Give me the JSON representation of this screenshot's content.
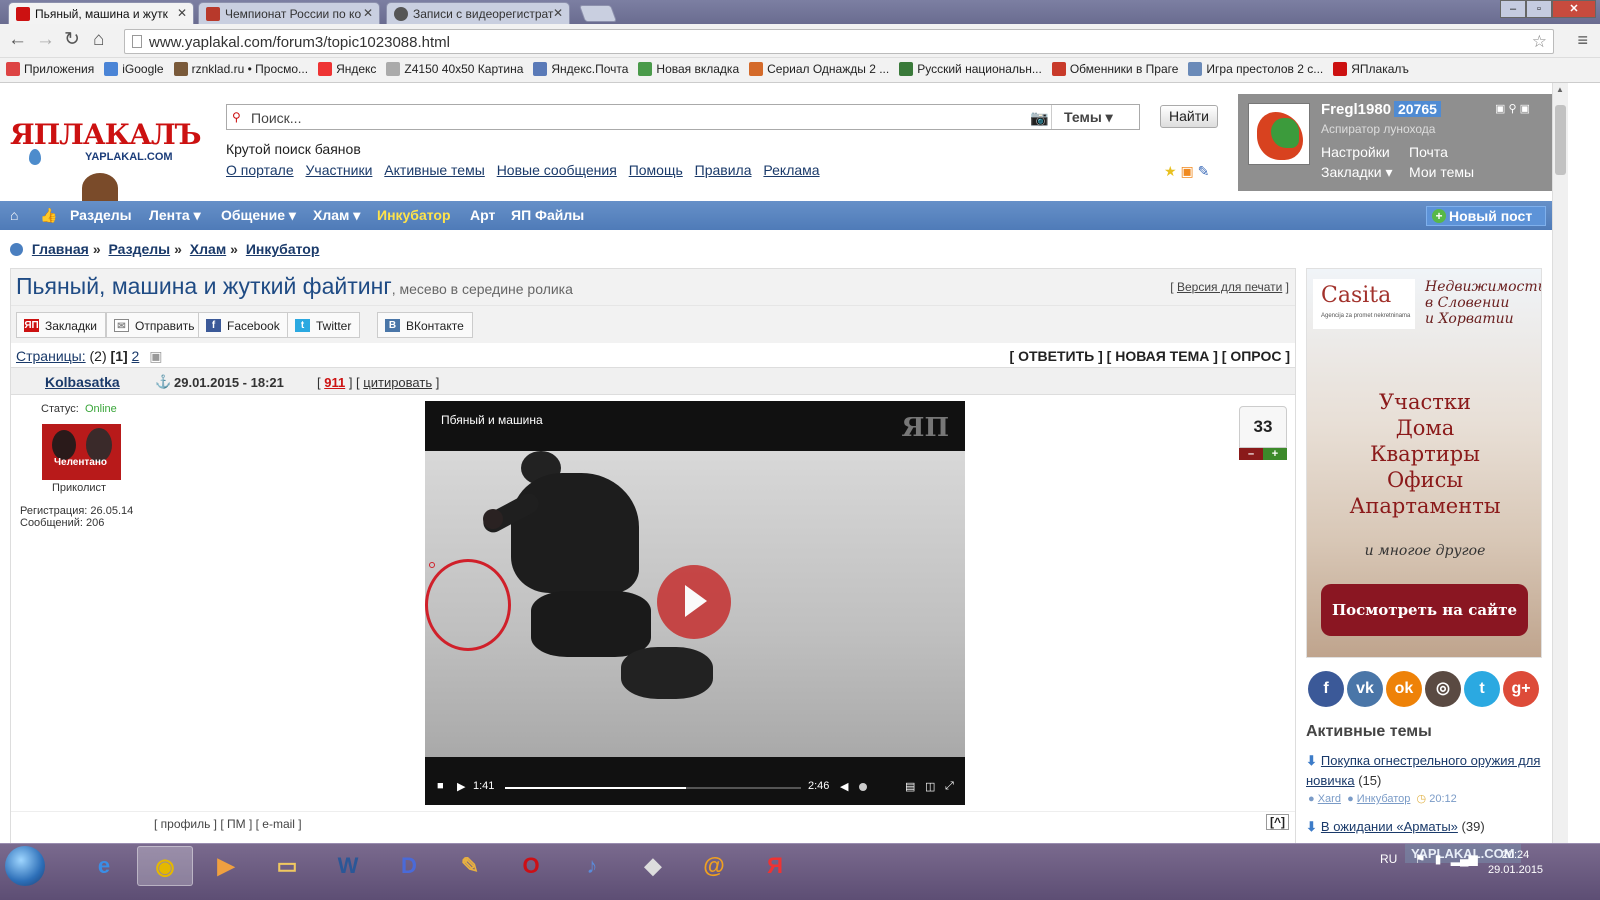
{
  "browser": {
    "tabs": [
      {
        "title": "Пьяный, машина и жутк",
        "favicon": "yaplakal-favicon",
        "color": "#c11",
        "active": true
      },
      {
        "title": "Чемпионат России по ко",
        "favicon": "video-favicon",
        "color": "#b8392b",
        "active": false
      },
      {
        "title": "Записи с видеорегистрат",
        "favicon": "globe-favicon",
        "color": "#555",
        "active": false
      }
    ],
    "url": "www.yaplakal.com/forum3/topic1023088.html",
    "bookmarks": [
      {
        "label": "Приложения",
        "color": "#d44"
      },
      {
        "label": "iGoogle",
        "color": "#4a84d6"
      },
      {
        "label": "rznklad.ru • Просмо...",
        "color": "#7a5a3a"
      },
      {
        "label": "Яндекс",
        "color": "#e33"
      },
      {
        "label": "Z4150 40x50 Картина",
        "color": "#aaa"
      },
      {
        "label": "Яндекс.Почта",
        "color": "#5a7ab8"
      },
      {
        "label": "Новая вкладка",
        "color": "#4a9a4a"
      },
      {
        "label": "Сериал Однажды 2 ...",
        "color": "#d46a2a"
      },
      {
        "label": "Русский национальн...",
        "color": "#3a7a3a"
      },
      {
        "label": "Обменники в Праге",
        "color": "#c83a2a"
      },
      {
        "label": "Игра престолов 2 с...",
        "color": "#6a8ab8"
      },
      {
        "label": "ЯПлакалъ",
        "color": "#c11"
      }
    ]
  },
  "header": {
    "logo_text": "ЯПЛАКАЛЪ",
    "logo_sub": "YAPLAKAL.COM",
    "search_placeholder": "Поиск...",
    "search_scope": "Темы",
    "search_button": "Найти",
    "slogan": "Крутой поиск баянов",
    "links": [
      "О портале",
      "Участники",
      "Активные темы",
      "Новые сообщения",
      "Помощь",
      "Правила",
      "Реклама"
    ]
  },
  "user": {
    "name": "Fregl1980",
    "reputation": "20765",
    "rank": "Аспиратор лунохода",
    "links": {
      "settings": "Настройки",
      "mail": "Почта",
      "bookmarks": "Закладки",
      "my_topics": "Мои темы"
    }
  },
  "menu": {
    "items": [
      "Разделы",
      "Лента",
      "Общение",
      "Хлам",
      "Инкубатор",
      "Арт",
      "ЯП Файлы"
    ],
    "new_post": "Новый пост"
  },
  "breadcrumb": [
    "Главная",
    "Разделы",
    "Хлам",
    "Инкубатор"
  ],
  "topic": {
    "title": "Пьяный, машина и жуткий файтинг",
    "subtitle": ", месево в середине ролика",
    "print_version": "Версия для печати",
    "share": [
      {
        "label": "Закладки",
        "icon": "yaplakal-bookmark-icon",
        "color": "#c11"
      },
      {
        "label": "Отправить",
        "icon": "envelope-icon",
        "color": "#888"
      },
      {
        "label": "Facebook",
        "icon": "facebook-icon",
        "color": "#3b5998"
      },
      {
        "label": "Twitter",
        "icon": "twitter-icon",
        "color": "#2ba9e1"
      },
      {
        "label": "ВКонтакте",
        "icon": "vk-icon",
        "color": "#4a76a8"
      }
    ],
    "pages_label": "Страницы:",
    "pages_count": "(2)",
    "current_page": "[1]",
    "next_page": "2",
    "actions": "[ ОТВЕТИТЬ ] [ НОВАЯ ТЕМА ] [ ОПРОС ]"
  },
  "post": {
    "author": "Kolbasatka",
    "date": "29.01.2015 - 18:21",
    "rating": "911",
    "quote": "цитировать",
    "status_label": "Статус:",
    "status_value": "Online",
    "avatar_caption": "Челентано",
    "rank": "Приколист",
    "registration": "Регистрация: 26.05.14",
    "messages": "Сообщений: 206",
    "score": "33",
    "score_minus": "–",
    "score_plus": "+",
    "foot_links": "[ профиль ] [ ПМ ] [ e-mail ]",
    "up": "[^]"
  },
  "video": {
    "title": "Пбяный и машина",
    "watermark": "ЯП",
    "time_current": "1:41",
    "time_total": "2:46",
    "progress": 0.61
  },
  "ad": {
    "brand": "Casita",
    "brand_sub": "Agencija za promet nekretninama",
    "tagline": [
      "Недвижимость",
      "в Словении",
      "и Хорватии"
    ],
    "lines": [
      "Участки",
      "Дома",
      "Квартиры",
      "Офисы",
      "Апартаменты"
    ],
    "more": "и многое другое",
    "cta": "Посмотреть на сайте"
  },
  "social": [
    {
      "icon": "facebook-icon",
      "glyph": "f",
      "color": "#3b5998"
    },
    {
      "icon": "vk-icon",
      "glyph": "vk",
      "color": "#4a76a8"
    },
    {
      "icon": "odnoklassniki-icon",
      "glyph": "ok",
      "color": "#ee8208"
    },
    {
      "icon": "instagram-icon",
      "glyph": "◎",
      "color": "#5a4a42"
    },
    {
      "icon": "twitter-icon",
      "glyph": "t",
      "color": "#2ba9e1"
    },
    {
      "icon": "google-plus-icon",
      "glyph": "g+",
      "color": "#dd4b39"
    }
  ],
  "active_topics": {
    "heading": "Активные темы",
    "items": [
      {
        "title": "Покупка огнестрельного оружия для новичка",
        "count": "(15)",
        "user": "Xard",
        "section": "Инкубатор",
        "time": "20:12"
      },
      {
        "title": "В ожидании «Арматы»",
        "count": "(39)"
      }
    ]
  },
  "taskbar": {
    "apps": [
      {
        "name": "internet-explorer-icon",
        "glyph": "e",
        "color": "#3a8ee6"
      },
      {
        "name": "chrome-icon",
        "glyph": "◉",
        "color": "#e5b800"
      },
      {
        "name": "media-player-icon",
        "glyph": "▶",
        "color": "#f0a040"
      },
      {
        "name": "explorer-icon",
        "glyph": "▭",
        "color": "#f0c860"
      },
      {
        "name": "word-icon",
        "glyph": "W",
        "color": "#2b5797"
      },
      {
        "name": "video-player-icon",
        "glyph": "D",
        "color": "#4a6ad8"
      },
      {
        "name": "paint-icon",
        "glyph": "✎",
        "color": "#e8b040"
      },
      {
        "name": "opera-icon",
        "glyph": "O",
        "color": "#cc0f16"
      },
      {
        "name": "speaker-icon",
        "glyph": "♪",
        "color": "#5a8ad8"
      },
      {
        "name": "gamepad-icon",
        "glyph": "◆",
        "color": "#ddd"
      },
      {
        "name": "mail-agent-icon",
        "glyph": "@",
        "color": "#f0a020"
      },
      {
        "name": "yandex-browser-icon",
        "glyph": "Я",
        "color": "#e33"
      }
    ],
    "lang": "RU",
    "time": "20:24",
    "date": "29.01.2015",
    "watermark": "YAPLAKAL.COM"
  }
}
